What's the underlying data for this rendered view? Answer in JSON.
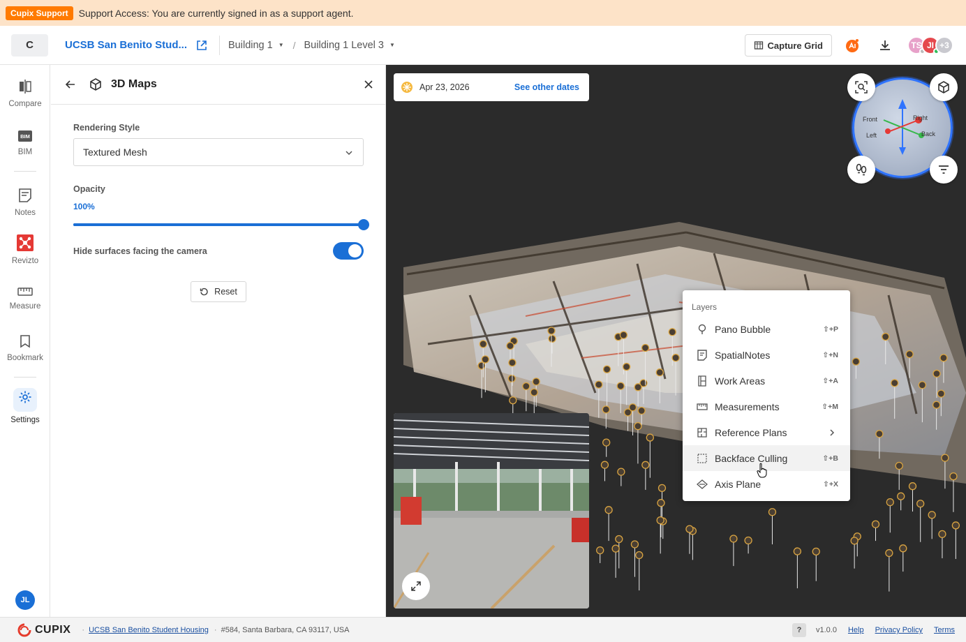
{
  "banner": {
    "badge": "Cupix Support",
    "message": "Support Access: You are currently signed in as a support agent."
  },
  "header": {
    "org_initial": "C",
    "project_name": "UCSB San Benito Stud...",
    "breadcrumb": [
      "Building 1",
      "Building 1 Level 3"
    ],
    "capture_grid_label": "Capture Grid",
    "avatars": [
      {
        "initials": "TS",
        "color": "#e7a1c9",
        "status": "#bbbbbb"
      },
      {
        "initials": "JI",
        "color": "#e5484d",
        "status": "#2ebd59"
      },
      {
        "initials": "+3",
        "color": "#c9c9cf",
        "status": ""
      }
    ]
  },
  "rail": {
    "items": [
      {
        "label": "Compare",
        "icon": "compare-icon"
      },
      {
        "label": "BIM",
        "icon": "bim-icon"
      },
      {
        "label": "Notes",
        "icon": "notes-icon"
      },
      {
        "label": "Revizto",
        "icon": "revizto-icon"
      },
      {
        "label": "Measure",
        "icon": "ruler-icon"
      },
      {
        "label": "Bookmark",
        "icon": "bookmark-icon"
      },
      {
        "label": "Settings",
        "icon": "gear-icon"
      }
    ],
    "user_initials": "JL"
  },
  "panel": {
    "title": "3D Maps",
    "rendering_style_label": "Rendering Style",
    "rendering_style_value": "Textured Mesh",
    "opacity_label": "Opacity",
    "opacity_value": "100%",
    "opacity_fraction": 1.0,
    "hide_surfaces_label": "Hide surfaces facing the camera",
    "hide_surfaces_on": true,
    "reset_label": "Reset"
  },
  "viewer": {
    "date": "Apr 23, 2026",
    "see_other_dates": "See other dates",
    "gizmo_labels": {
      "front": "Front",
      "right": "Right",
      "left": "Left",
      "back": "Back"
    }
  },
  "layers_menu": {
    "title": "Layers",
    "items": [
      {
        "label": "Pano Bubble",
        "shortcut": "⇧+P",
        "icon": "pano-bubble-icon"
      },
      {
        "label": "SpatialNotes",
        "shortcut": "⇧+N",
        "icon": "spatial-note-icon"
      },
      {
        "label": "Work Areas",
        "shortcut": "⇧+A",
        "icon": "work-area-icon"
      },
      {
        "label": "Measurements",
        "shortcut": "⇧+M",
        "icon": "ruler-icon"
      },
      {
        "label": "Reference Plans",
        "shortcut": "",
        "icon": "floor-plan-icon",
        "has_submenu": true
      },
      {
        "label": "Backface Culling",
        "shortcut": "⇧+B",
        "icon": "backface-icon",
        "hovered": true
      },
      {
        "label": "Axis Plane",
        "shortcut": "⇧+X",
        "icon": "axis-plane-icon"
      }
    ]
  },
  "footer": {
    "brand": "CUPIX",
    "project_link": "UCSB San Benito Student Housing",
    "address": "#584, Santa Barbara, CA 93117, USA",
    "help_glyph": "?",
    "version": "v1.0.0",
    "help": "Help",
    "privacy": "Privacy Policy",
    "terms": "Terms"
  },
  "colors": {
    "accent": "#1a6fd6",
    "brand_orange": "#ff7a00",
    "banner_bg": "#fde3c8"
  }
}
